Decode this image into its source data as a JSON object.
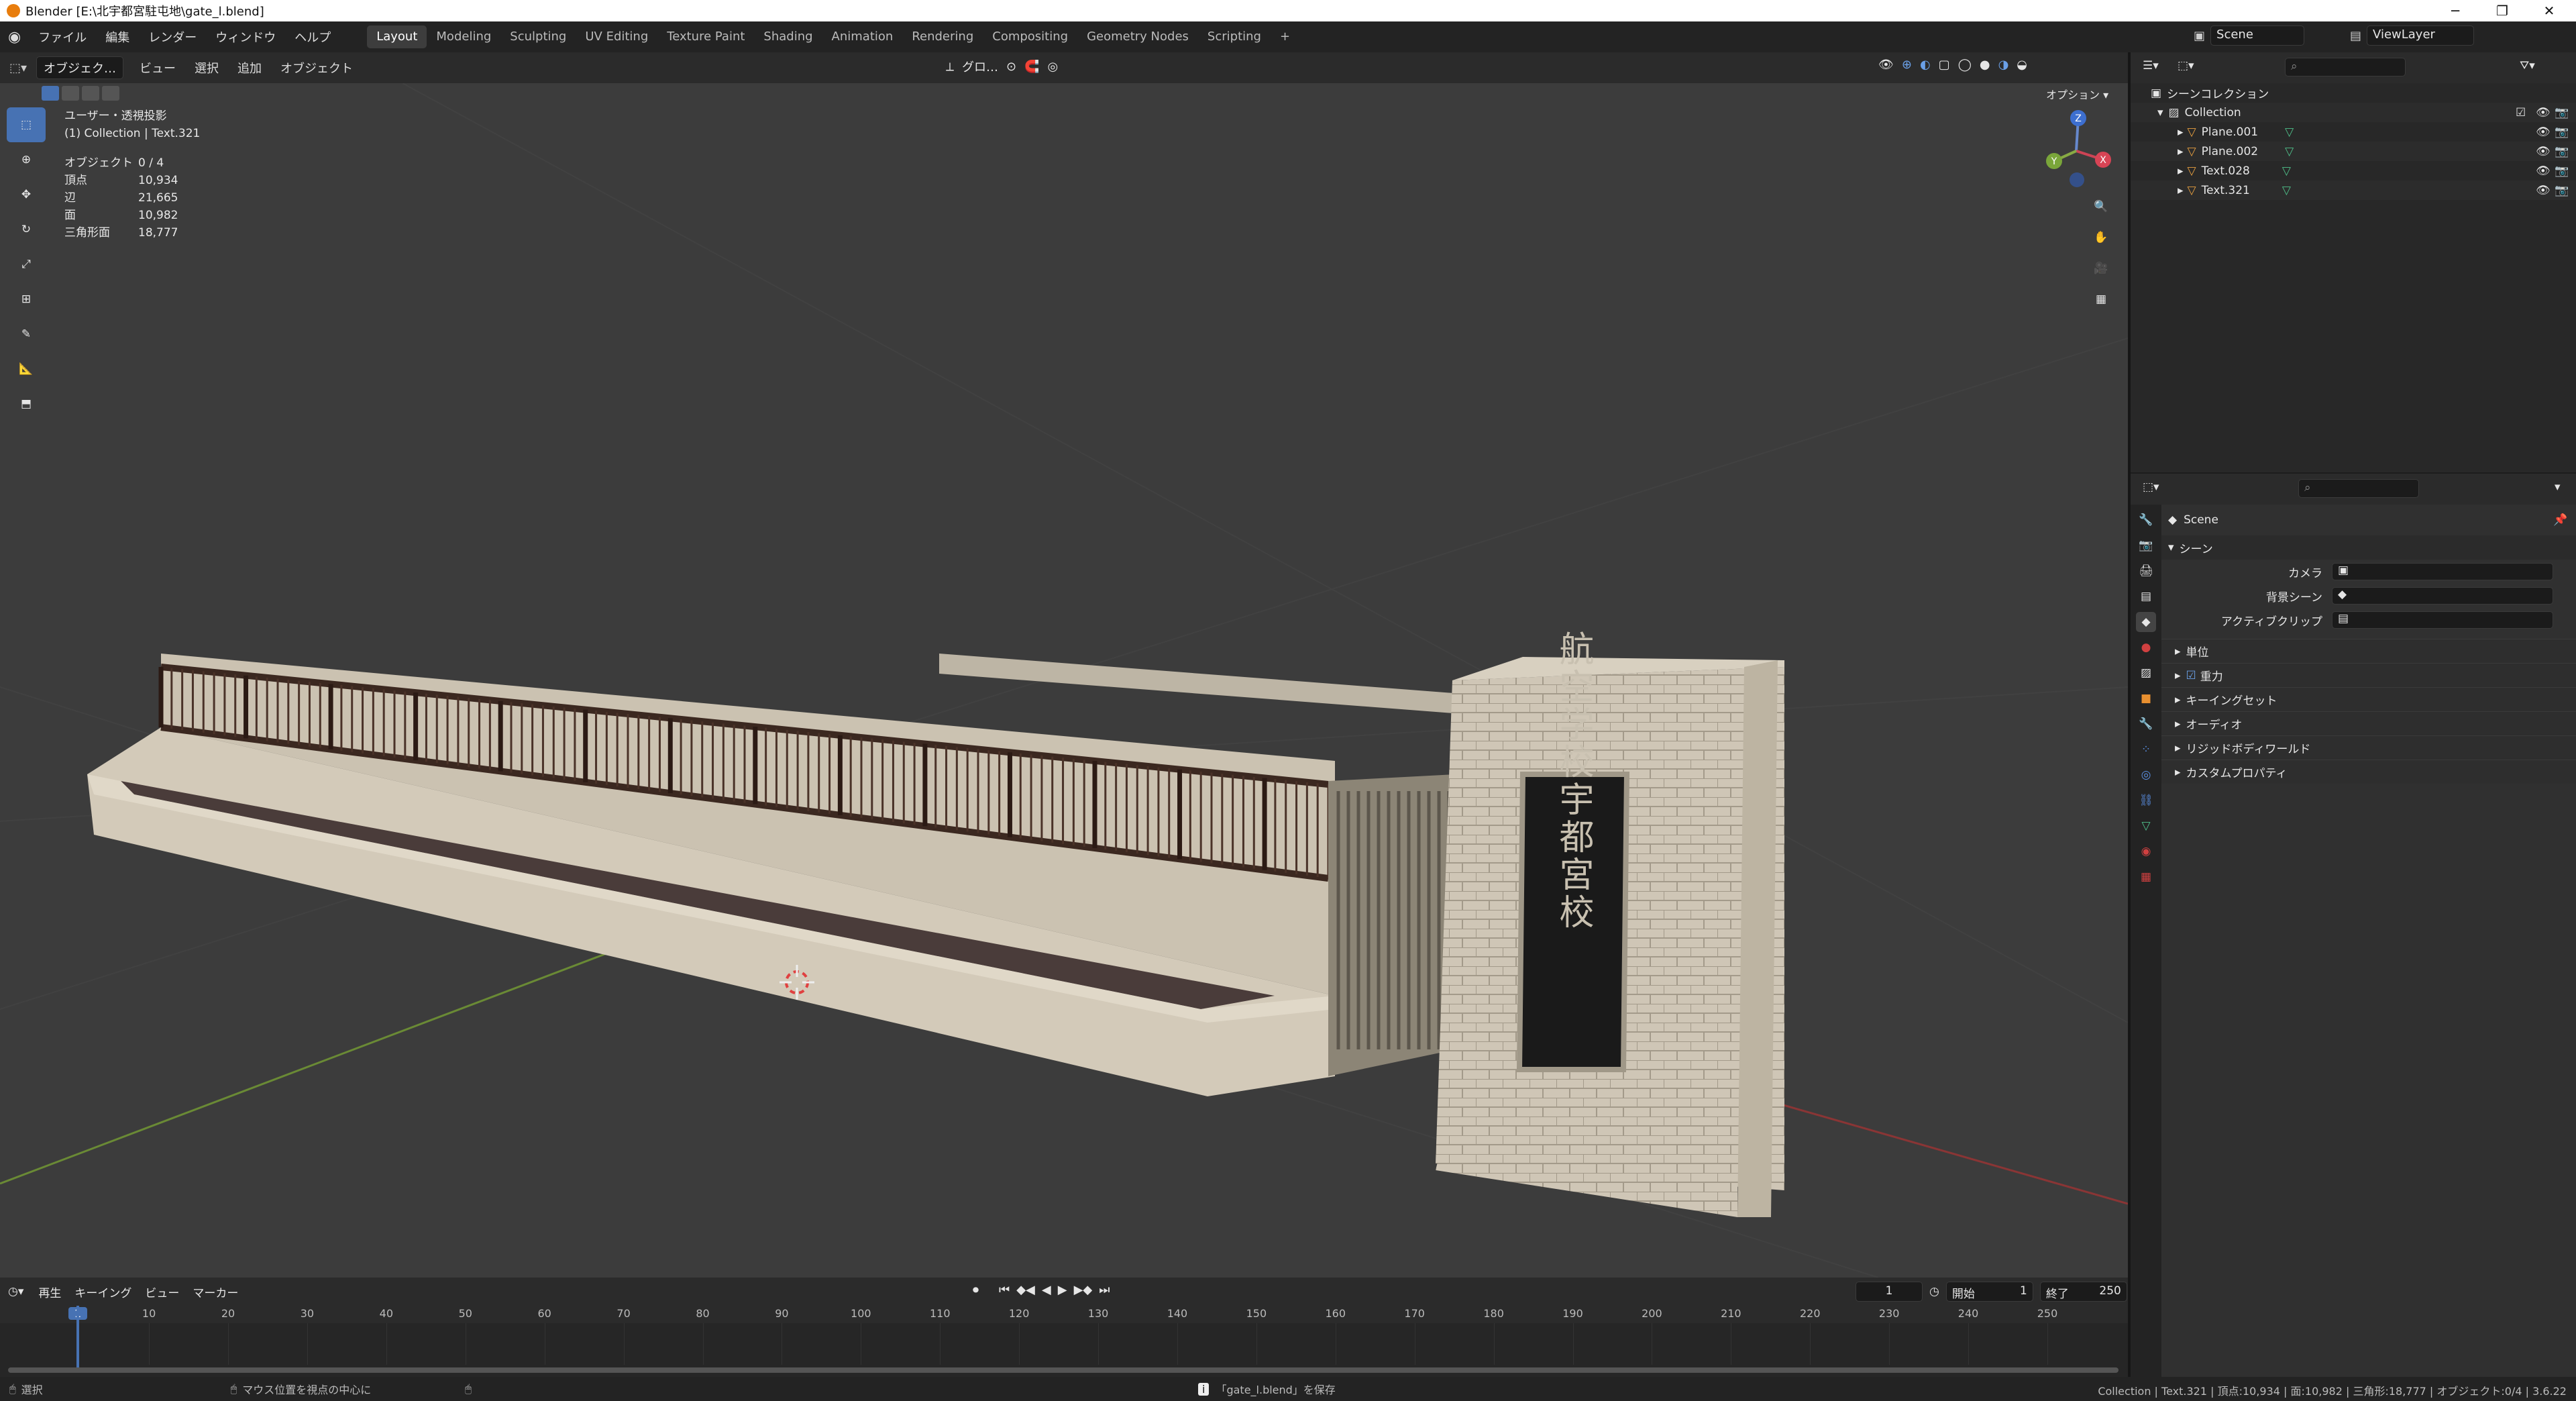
{
  "window": {
    "title": "Blender [E:\\北宇都宮駐屯地\\gate_l.blend]"
  },
  "menu": [
    "ファイル",
    "編集",
    "レンダー",
    "ウィンドウ",
    "ヘルプ"
  ],
  "workspaces": [
    "Layout",
    "Modeling",
    "Sculpting",
    "UV Editing",
    "Texture Paint",
    "Shading",
    "Animation",
    "Rendering",
    "Compositing",
    "Geometry Nodes",
    "Scripting"
  ],
  "active_workspace": "Layout",
  "scene_name": "Scene",
  "view_layer": "ViewLayer",
  "viewport_header": {
    "mode": "オブジェク…",
    "menus": [
      "ビュー",
      "選択",
      "追加",
      "オブジェクト"
    ],
    "transform_orientation": "グロ…",
    "options_label": "オプション"
  },
  "overlay": {
    "view_name": "ユーザー・透視投影",
    "collection_info": "(1) Collection | Text.321",
    "stats": [
      {
        "k": "オブジェクト",
        "v": "0 / 4"
      },
      {
        "k": "頂点",
        "v": "10,934"
      },
      {
        "k": "辺",
        "v": "21,665"
      },
      {
        "k": "面",
        "v": "10,982"
      },
      {
        "k": "三角形面",
        "v": "18,777"
      }
    ]
  },
  "gizmo": {
    "z": "Z",
    "x": "X",
    "y": "Y"
  },
  "sign_text": "航空学校宇都宮校",
  "outliner": {
    "root": "シーンコレクション",
    "collection": "Collection",
    "items": [
      "Plane.001",
      "Plane.002",
      "Text.028",
      "Text.321"
    ]
  },
  "properties": {
    "title": "Scene",
    "section": "シーン",
    "fields": [
      {
        "label": "カメラ"
      },
      {
        "label": "背景シーン"
      },
      {
        "label": "アクティブクリップ"
      }
    ],
    "panels": [
      "単位",
      "重力",
      "キーイングセット",
      "オーディオ",
      "リジッドボディワールド",
      "カスタムプロパティ"
    ]
  },
  "timeline": {
    "menus": [
      "再生",
      "キーイング",
      "ビュー",
      "マーカー"
    ],
    "current_frame": "1",
    "start_label": "開始",
    "start": "1",
    "end_label": "終了",
    "end": "250",
    "ticks": [
      "1",
      "10",
      "20",
      "30",
      "40",
      "50",
      "60",
      "70",
      "80",
      "90",
      "100",
      "110",
      "120",
      "130",
      "140",
      "150",
      "160",
      "170",
      "180",
      "190",
      "200",
      "210",
      "220",
      "230",
      "240",
      "250"
    ]
  },
  "statusbar": {
    "left": "選択",
    "mid": "マウス位置を視点の中心に",
    "message": "「gate_l.blend」を保存",
    "right": "Collection | Text.321 | 頂点:10,934 | 面:10,982 | 三角形:18,777 | オブジェクト:0/4 | 3.6.22"
  },
  "colors": {
    "accent": "#4772b3",
    "header": "#2b2b2b",
    "viewport": "#3c3c3c",
    "brand": "#e87d0d"
  }
}
